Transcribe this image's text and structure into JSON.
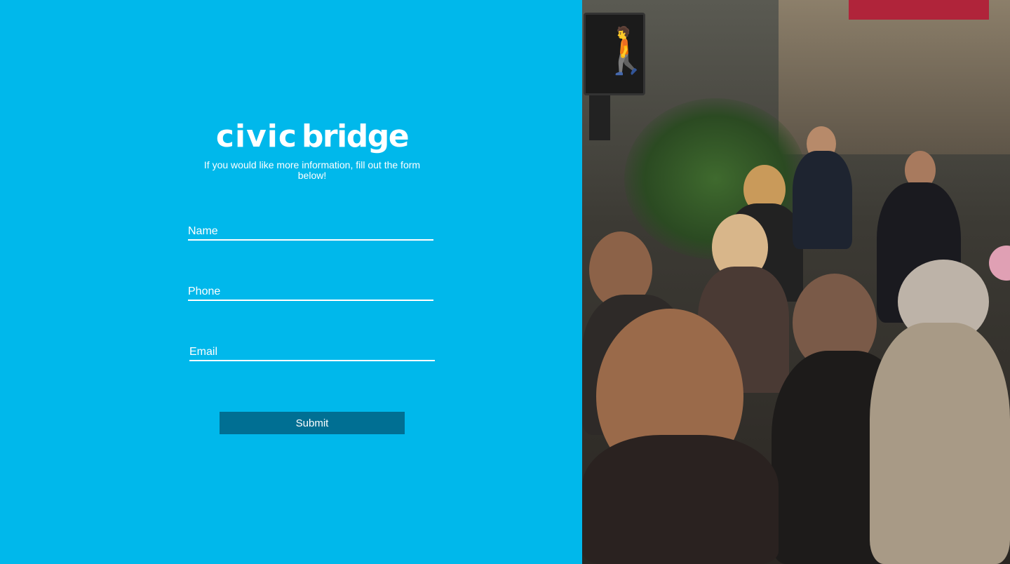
{
  "brand": {
    "logo_word_1": "civic",
    "logo_word_2": "bridge"
  },
  "form": {
    "tagline": "If you would like more information, fill out the form below!",
    "fields": {
      "name": {
        "placeholder": "Name",
        "value": ""
      },
      "phone": {
        "placeholder": "Phone",
        "value": ""
      },
      "email": {
        "placeholder": "Email",
        "value": ""
      }
    },
    "submit_label": "Submit"
  },
  "right_panel": {
    "signal_icon": "walk-signal-icon"
  },
  "colors": {
    "panel_background": "#00b8eb",
    "button_background": "#006f93",
    "text": "#ffffff"
  }
}
